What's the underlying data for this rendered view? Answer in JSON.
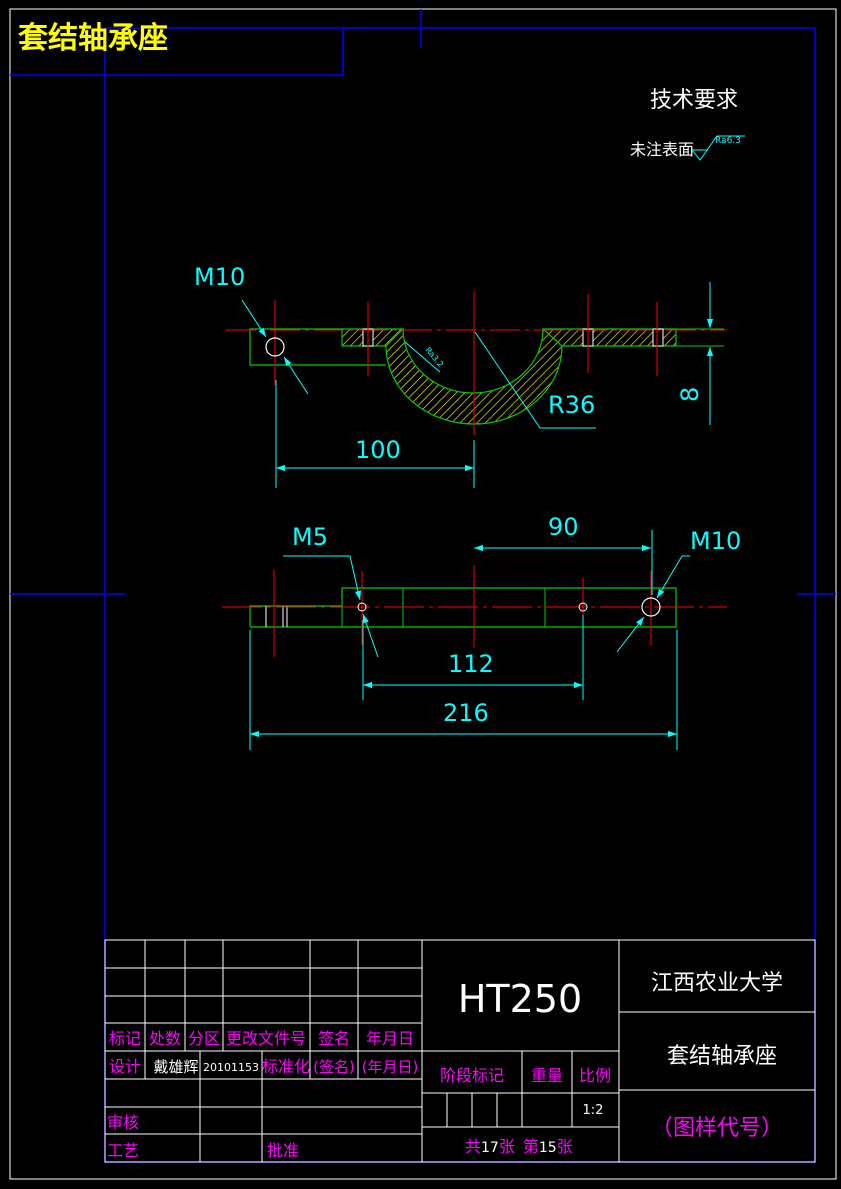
{
  "drawing_title": "套结轴承座",
  "tech_requirements": {
    "heading": "技术要求",
    "note": "未注表面",
    "roughness": "Ra6.3"
  },
  "view_top": {
    "thread_label": "M10",
    "radius_label": "R36",
    "roughness_label": "Ra3.2",
    "dim_length": "100",
    "dim_thickness": "8"
  },
  "view_front": {
    "thread_small_label": "M5",
    "thread_large_label": "M10",
    "dim_90": "90",
    "dim_112": "112",
    "dim_216": "216"
  },
  "title_block": {
    "material": "HT250",
    "school": "江西农业大学",
    "part_name": "套结轴承座",
    "drawing_code": "（图样代号）",
    "header_labels": [
      "标记",
      "处数",
      "分区",
      "更改文件号",
      "签名",
      "年月日"
    ],
    "design_label": "设计",
    "designer": "戴雄辉",
    "student_id": "20101153",
    "standardize_label": "标准化",
    "sign_label": "(签名)",
    "date_label": "(年月日)",
    "review_label": "审核",
    "process_label": "工艺",
    "approve_label": "批准",
    "stage_label": "阶段标记",
    "weight_label": "重量",
    "scale_label": "比例",
    "scale_value": "1:2",
    "sheets_total_prefix": "共",
    "sheets_total": "17",
    "sheets_total_suffix": "张",
    "sheet_no_prefix": "第",
    "sheet_no": "15",
    "sheet_no_suffix": "张"
  },
  "colors": {
    "background": "#000000",
    "border": "#ffffff",
    "frame": "#0000ff",
    "outline": "#00cc00",
    "centerline": "#ff0000",
    "dimension": "#00ffff",
    "hatch": "#ffff00",
    "label": "#ff00ff",
    "title": "#ffff00"
  }
}
